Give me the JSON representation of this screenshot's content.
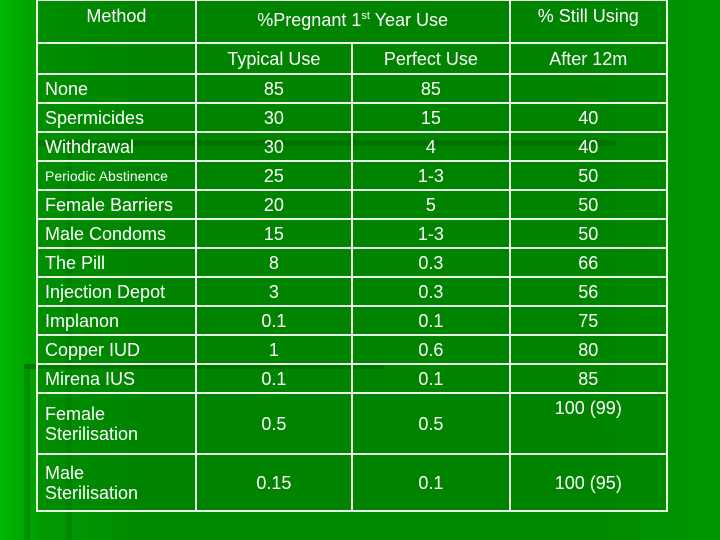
{
  "table": {
    "header": {
      "method": "Method",
      "pregnant_prefix": "%Pregnant 1",
      "pregnant_sup": "st",
      "pregnant_suffix": " Year Use",
      "still_using": "% Still Using",
      "typical_use": "Typical Use",
      "perfect_use": "Perfect Use",
      "after_12m": "After 12m"
    },
    "rows": [
      {
        "method": "None",
        "typical": "85",
        "perfect": "85",
        "still_using": ""
      },
      {
        "method": "Spermicides",
        "typical": "30",
        "perfect": "15",
        "still_using": "40"
      },
      {
        "method": "Withdrawal",
        "typical": "30",
        "perfect": "4",
        "still_using": "40"
      },
      {
        "method": "Periodic Abstinence",
        "typical": "25",
        "perfect": "1-3",
        "still_using": "50"
      },
      {
        "method": "Female Barriers",
        "typical": "20",
        "perfect": "5",
        "still_using": "50"
      },
      {
        "method": "Male Condoms",
        "typical": "15",
        "perfect": "1-3",
        "still_using": "50"
      },
      {
        "method": "The Pill",
        "typical": "8",
        "perfect": "0.3",
        "still_using": "66"
      },
      {
        "method": "Injection Depot",
        "typical": "3",
        "perfect": "0.3",
        "still_using": "56"
      },
      {
        "method": "Implanon",
        "typical": "0.1",
        "perfect": "0.1",
        "still_using": "75"
      },
      {
        "method": "Copper IUD",
        "typical": "1",
        "perfect": "0.6",
        "still_using": "80"
      },
      {
        "method": "Mirena IUS",
        "typical": "0.1",
        "perfect": "0.1",
        "still_using": "85"
      },
      {
        "method_line1": "Female",
        "method_line2": "Sterilisation",
        "typical": "0.5",
        "perfect": "0.5",
        "still_using": "100 (99)"
      },
      {
        "method_line1": "Male",
        "method_line2": "Sterilisation",
        "typical": "0.15",
        "perfect": "0.1",
        "still_using": "100 (95)"
      }
    ]
  }
}
